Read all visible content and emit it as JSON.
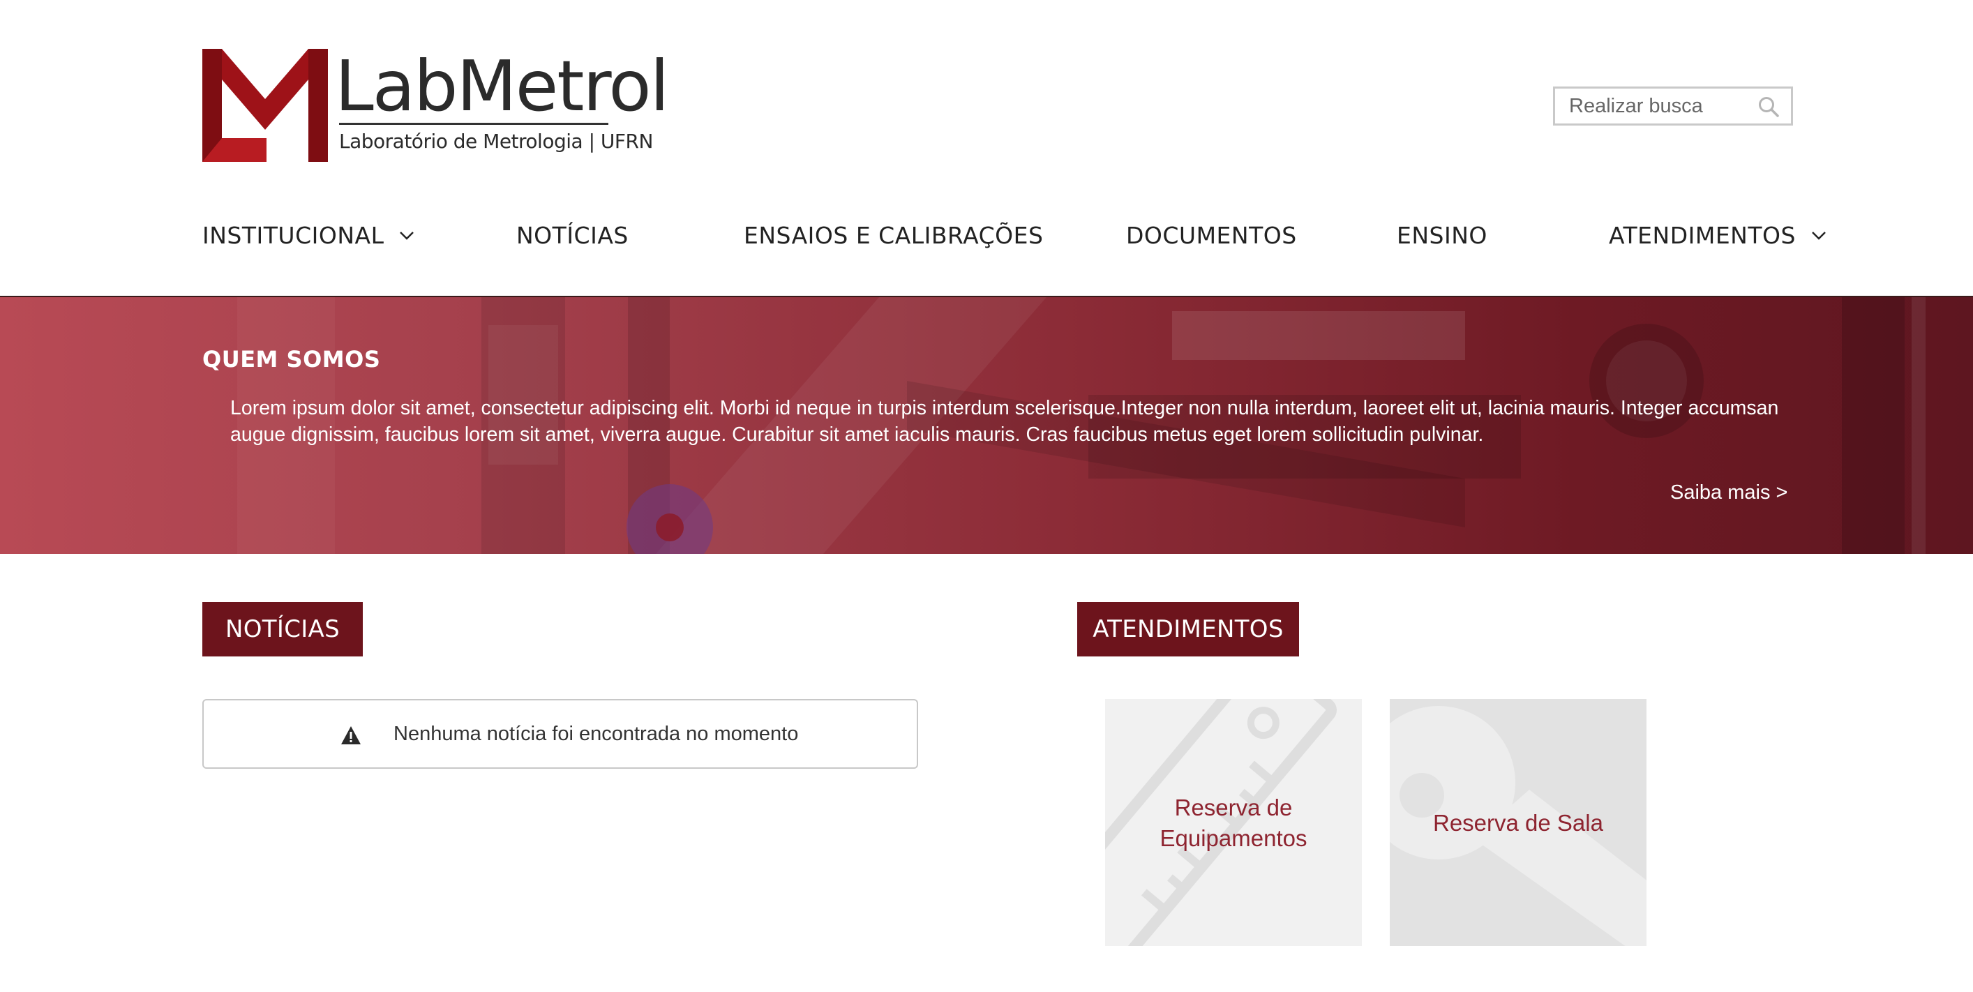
{
  "header": {
    "logo": {
      "title": "LabMetrol",
      "subtitle": "Laboratório de Metrologia | UFRN",
      "mark_color": "#9e1218"
    },
    "search": {
      "placeholder": "Realizar busca",
      "value": ""
    }
  },
  "nav": {
    "items": [
      {
        "label": "INSTITUCIONAL",
        "has_dropdown": true
      },
      {
        "label": "NOTÍCIAS",
        "has_dropdown": false
      },
      {
        "label": "ENSAIOS E CALIBRAÇÕES",
        "has_dropdown": false
      },
      {
        "label": "DOCUMENTOS",
        "has_dropdown": false
      },
      {
        "label": "ENSINO",
        "has_dropdown": false
      },
      {
        "label": "ATENDIMENTOS",
        "has_dropdown": true
      }
    ]
  },
  "hero": {
    "title": "QUEM SOMOS",
    "text": "Lorem ipsum dolor sit amet, consectetur adipiscing elit. Morbi id neque in turpis interdum scelerisque.Integer non nulla interdum, laoreet elit ut, lacinia mauris. Integer accumsan augue dignissim, faucibus lorem sit amet, viverra augue. Curabitur sit amet iaculis mauris. Cras faucibus metus eget lorem sollicitudin pulvinar.",
    "link_label": "Saiba mais >"
  },
  "news": {
    "section_title": "NOTÍCIAS",
    "empty_message": "Nenhuma notícia foi encontrada no momento"
  },
  "attendance": {
    "section_title": "ATENDIMENTOS",
    "cards": [
      {
        "label": "Reserva de Equipamentos",
        "icon": "ruler-icon"
      },
      {
        "label": "Reserva de Sala",
        "icon": "key-icon"
      }
    ]
  },
  "colors": {
    "brand_dark": "#6d141c",
    "brand_text": "#8e2430",
    "hero_left": "#b84a55",
    "hero_right": "#5e1620"
  }
}
